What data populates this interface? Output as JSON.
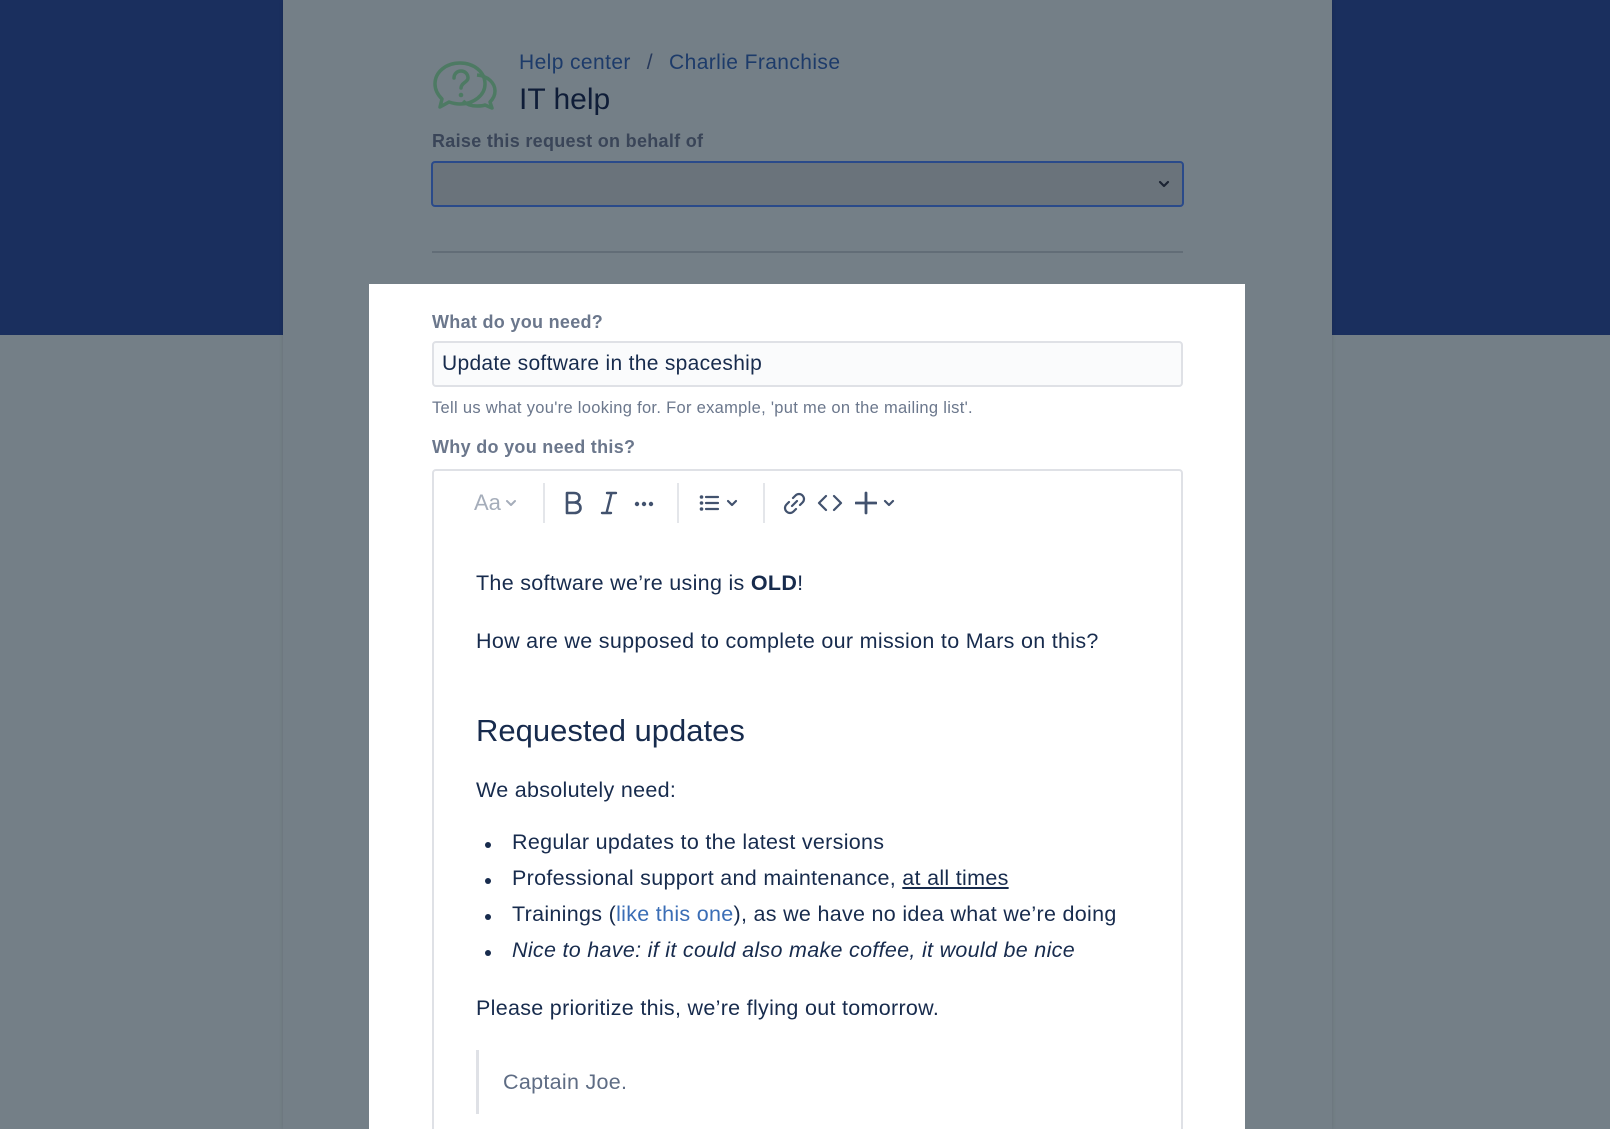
{
  "header": {
    "breadcrumb": [
      "Help center",
      "Charlie Franchise"
    ],
    "breadcrumb_separator": "/",
    "title": "IT help",
    "icon": "chat-question-icon"
  },
  "behalf": {
    "label": "Raise this request on behalf of",
    "value": ""
  },
  "summary": {
    "label": "What do you need?",
    "value": "Update software in the spaceship",
    "helper": "Tell us what you're looking for. For example, 'put me on the mailing list'."
  },
  "description": {
    "label": "Why do you need this?",
    "toolbar": {
      "text_style": "Aa",
      "icons": [
        "text-style-icon",
        "bold-icon",
        "italic-icon",
        "more-formatting-icon",
        "bullet-list-icon",
        "link-icon",
        "code-icon",
        "insert-icon"
      ]
    },
    "body": {
      "line1_prefix": "The software we’re using is ",
      "line1_bold": "OLD",
      "line1_suffix": "!",
      "line2": "How are we supposed to complete our mission to Mars on this?",
      "heading": "Requested updates",
      "line3": "We absolutely need:",
      "bullets": {
        "b1": "Regular updates to the latest versions",
        "b2_prefix": "Professional support and maintenance, ",
        "b2_underline": "at all times",
        "b3_prefix": "Trainings (",
        "b3_link": "like this one",
        "b3_suffix": "), as we have no idea what we’re doing",
        "b4": "Nice to have: if it could also make coffee, it would be nice"
      },
      "line4": "Please prioritize this, we’re flying out tomorrow.",
      "quote": "Captain Joe."
    }
  },
  "colors": {
    "page_top": "#1a2f5e",
    "overlay": "#747f87",
    "link": "#3a6db5",
    "text": "#172b4d"
  }
}
